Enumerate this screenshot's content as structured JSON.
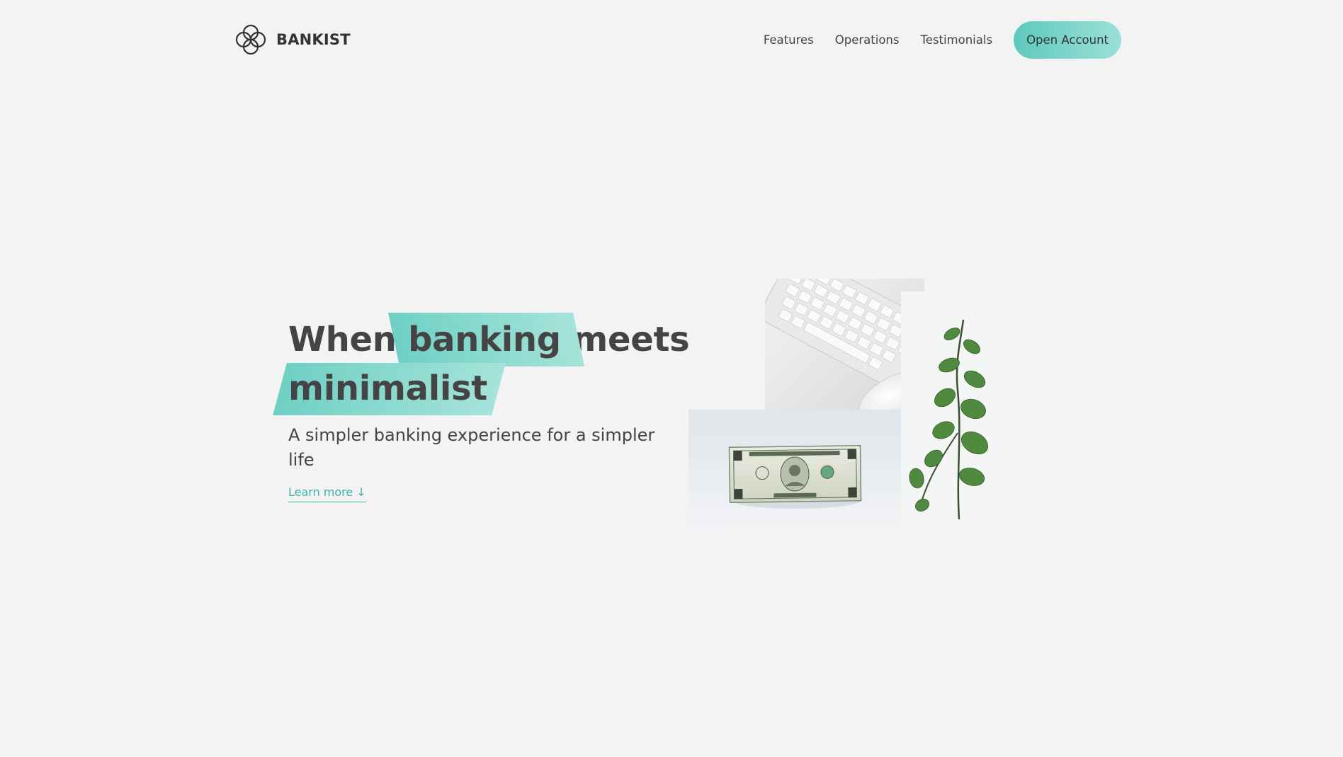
{
  "header": {
    "brand_name": "BANKIST",
    "nav": [
      {
        "label": "Features"
      },
      {
        "label": "Operations"
      },
      {
        "label": "Testimonials"
      }
    ],
    "cta_label": "Open Account"
  },
  "hero": {
    "headline_before": "When",
    "headline_highlight_1": "banking",
    "headline_after": "meets",
    "headline_highlight_2": "minimalist",
    "subtitle": "A simpler banking experience for a simpler life",
    "learn_more": "Learn more ↓"
  },
  "colors": {
    "accent": "#5ec9bc",
    "accent_light": "#9ce0d8",
    "link": "#39b3a7",
    "background": "#f3f3f3",
    "text": "#444444"
  },
  "icons": {
    "logo": "four-circle-logo-icon"
  }
}
